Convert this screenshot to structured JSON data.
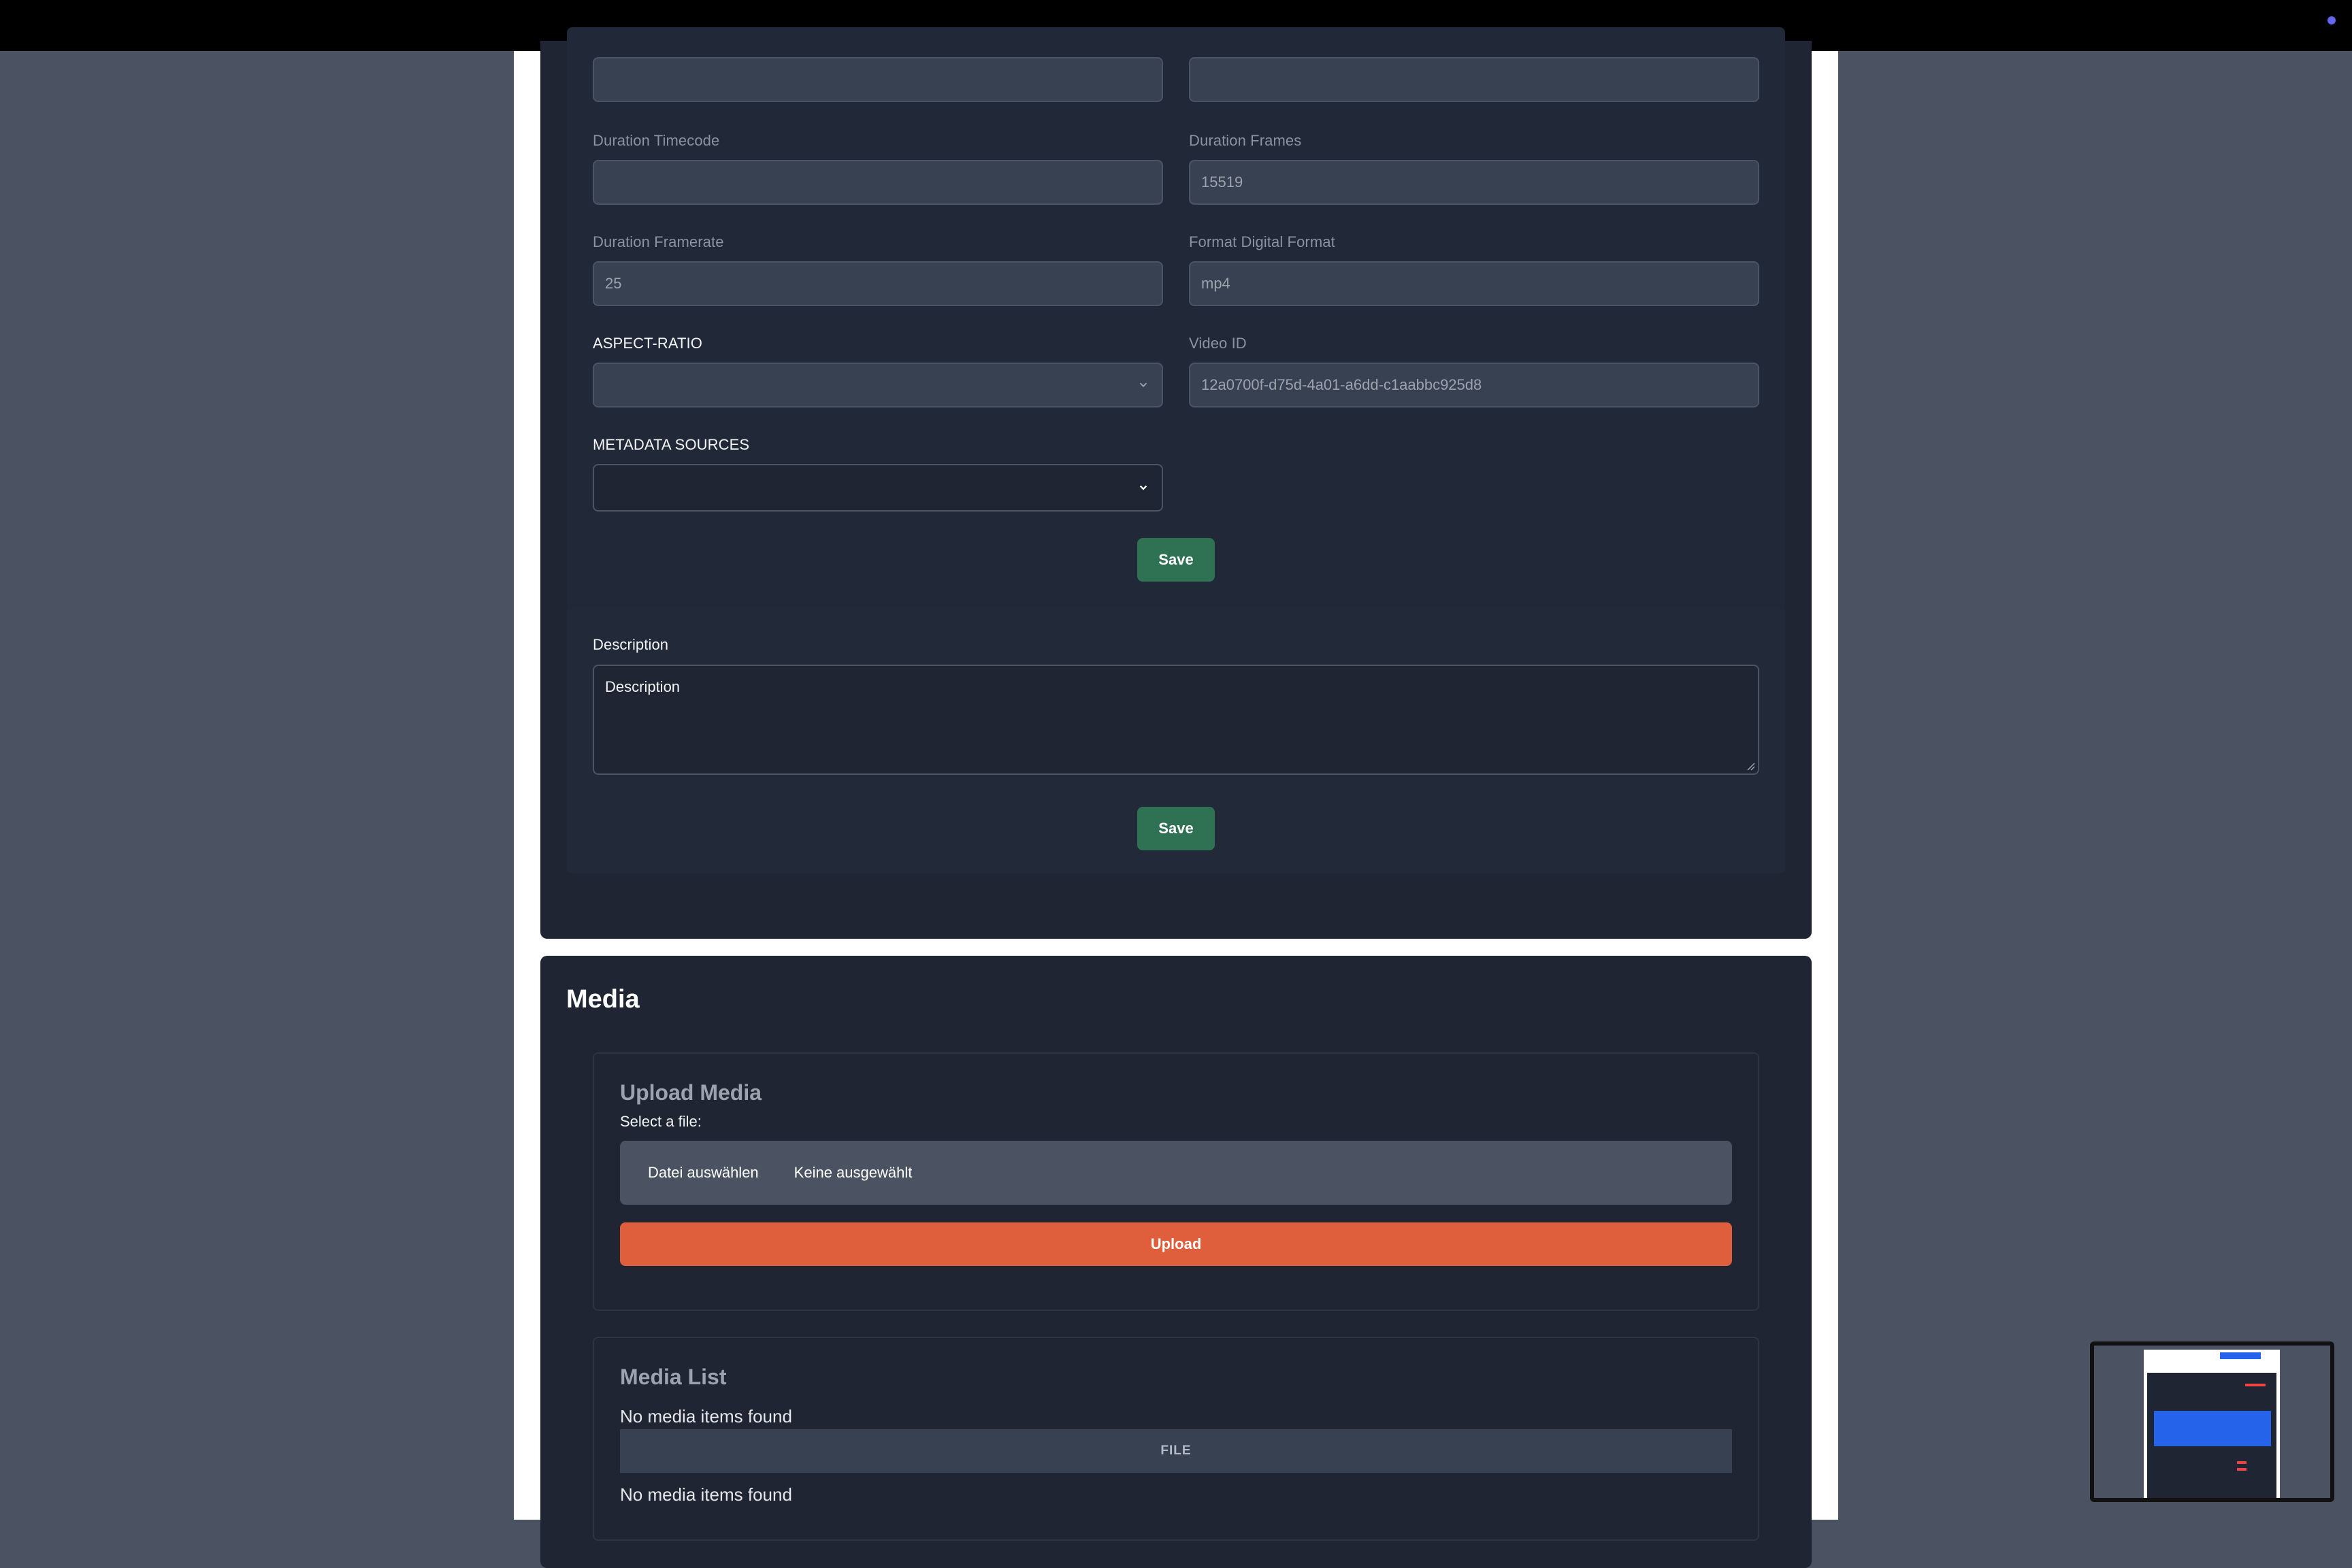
{
  "fields": {
    "duration_timecode": {
      "label": "Duration Timecode",
      "value": ""
    },
    "duration_frames": {
      "label": "Duration Frames",
      "value": "15519"
    },
    "duration_framerate": {
      "label": "Duration Framerate",
      "value": "25"
    },
    "format_digital_format": {
      "label": "Format Digital Format",
      "value": "mp4"
    },
    "aspect_ratio": {
      "label": "ASPECT-RATIO",
      "value": ""
    },
    "video_id": {
      "label": "Video ID",
      "value": "12a0700f-d75d-4a01-a6dd-c1aabbc925d8"
    },
    "metadata_sources": {
      "label": "METADATA SOURCES",
      "value": ""
    }
  },
  "save_label": "Save",
  "description": {
    "label": "Description",
    "placeholder": "Description"
  },
  "media": {
    "title": "Media",
    "upload": {
      "heading": "Upload Media",
      "select_label": "Select a file:",
      "choose_button": "Datei auswählen",
      "file_status": "Keine ausgewählt",
      "upload_button": "Upload"
    },
    "list": {
      "heading": "Media List",
      "empty_message": "No media items found",
      "column_file": "FILE"
    }
  },
  "colors": {
    "save": "#2f7153",
    "upload": "#df5e3c",
    "accent_dot": "#6366f1"
  }
}
